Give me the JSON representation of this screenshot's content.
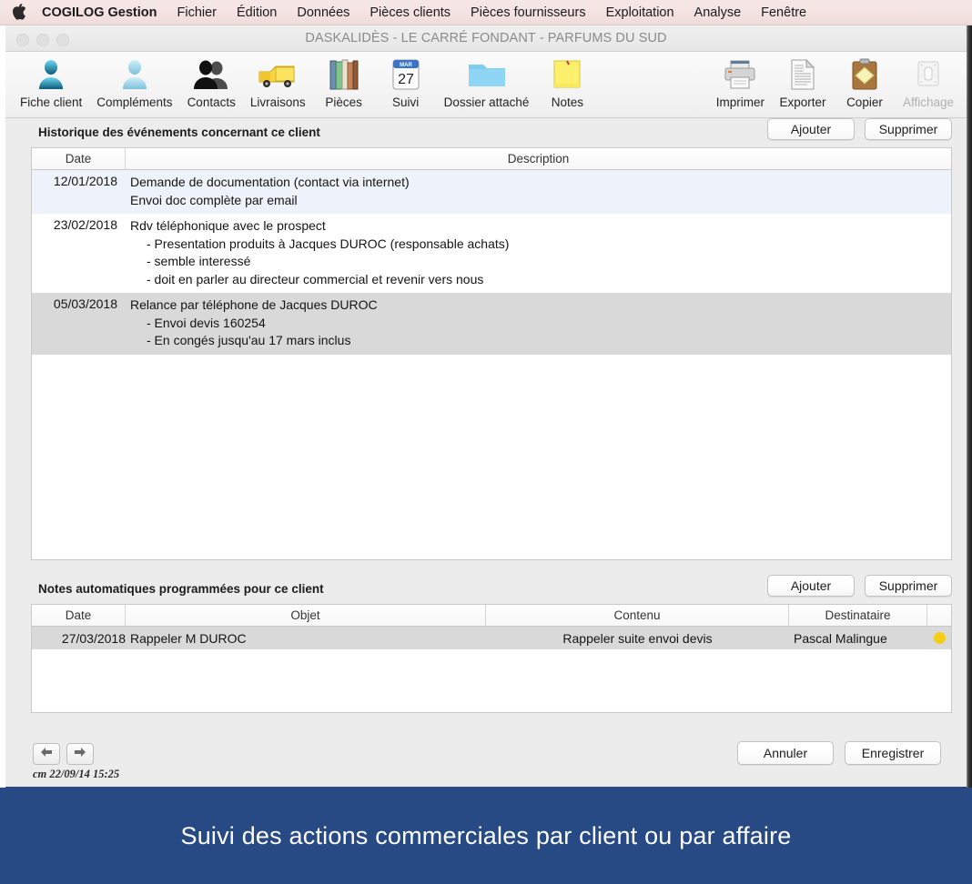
{
  "menubar": {
    "apple_icon": "apple-logo-icon",
    "items": [
      {
        "label": "COGILOG Gestion",
        "bold": true
      },
      {
        "label": "Fichier"
      },
      {
        "label": "Édition"
      },
      {
        "label": "Données"
      },
      {
        "label": "Pièces clients"
      },
      {
        "label": "Pièces fournisseurs"
      },
      {
        "label": "Exploitation"
      },
      {
        "label": "Analyse"
      },
      {
        "label": "Fenêtre"
      }
    ]
  },
  "window": {
    "title": "DASKALIDÈS - LE CARRÉ FONDANT - PARFUMS DU SUD",
    "traffic_lights": [
      "close-button",
      "minimize-button",
      "zoom-button"
    ]
  },
  "toolbar": {
    "left_items": [
      {
        "label": "Fiche client",
        "icon": "person-icon",
        "disabled": false
      },
      {
        "label": "Compléments",
        "icon": "person-light-icon",
        "disabled": false
      },
      {
        "label": "Contacts",
        "icon": "two-people-icon",
        "disabled": false
      },
      {
        "label": "Livraisons",
        "icon": "truck-icon",
        "disabled": false
      },
      {
        "label": "Pièces",
        "icon": "books-icon",
        "disabled": false
      },
      {
        "label": "Suivi",
        "icon": "calendar-27-icon",
        "disabled": false
      },
      {
        "label": "Dossier attaché",
        "icon": "folder-icon",
        "disabled": false
      },
      {
        "label": "Notes",
        "icon": "sticky-note-icon",
        "disabled": false
      }
    ],
    "right_items": [
      {
        "label": "Imprimer",
        "icon": "printer-icon",
        "disabled": false
      },
      {
        "label": "Exporter",
        "icon": "document-icon",
        "disabled": false
      },
      {
        "label": "Copier",
        "icon": "clipboard-icon",
        "disabled": false
      },
      {
        "label": "Affichage",
        "icon": "display-switch-icon",
        "disabled": true
      }
    ],
    "calendar_month": "MAR",
    "calendar_day": "27"
  },
  "history": {
    "title": "Historique des événements concernant ce client",
    "add_label": "Ajouter",
    "delete_label": "Supprimer",
    "columns": [
      "Date",
      "Description"
    ],
    "rows": [
      {
        "date": "12/01/2018",
        "lines": [
          "Demande de documentation (contact via internet)"
        ],
        "sub_lines": [
          "Envoi doc complète par email"
        ],
        "style": "blue"
      },
      {
        "date": "23/02/2018",
        "lines": [
          "Rdv téléphonique avec le prospect"
        ],
        "sub_lines": [
          "- Presentation produits à Jacques DUROC (responsable achats)",
          "- semble interessé",
          "- doit en parler au directeur commercial et revenir vers nous"
        ],
        "style": "white"
      },
      {
        "date": "05/03/2018",
        "lines": [
          "Relance par téléphone de Jacques DUROC"
        ],
        "sub_lines": [
          "- Envoi devis 160254",
          "- En congés jusqu'au 17 mars inclus"
        ],
        "style": "grey"
      }
    ]
  },
  "notes": {
    "title": "Notes automatiques programmées pour ce client",
    "add_label": "Ajouter",
    "delete_label": "Supprimer",
    "columns": [
      "Date",
      "Objet",
      "Contenu",
      "Destinataire",
      ""
    ],
    "rows": [
      {
        "date": "27/03/2018",
        "objet": "Rappeler M DUROC",
        "contenu": "Rappeler suite envoi devis",
        "destinataire": "Pascal Malingue",
        "flag_color": "#f7cc15",
        "style": "grey"
      }
    ]
  },
  "footer": {
    "back_icon": "arrow-left-icon",
    "forward_icon": "arrow-right-icon",
    "stamp": "cm 22/09/14 15:25",
    "cancel_label": "Annuler",
    "save_label": "Enregistrer"
  },
  "caption": {
    "text": "Suivi des actions commerciales par client ou par affaire",
    "background": "#274a85",
    "color": "#ffffff"
  }
}
